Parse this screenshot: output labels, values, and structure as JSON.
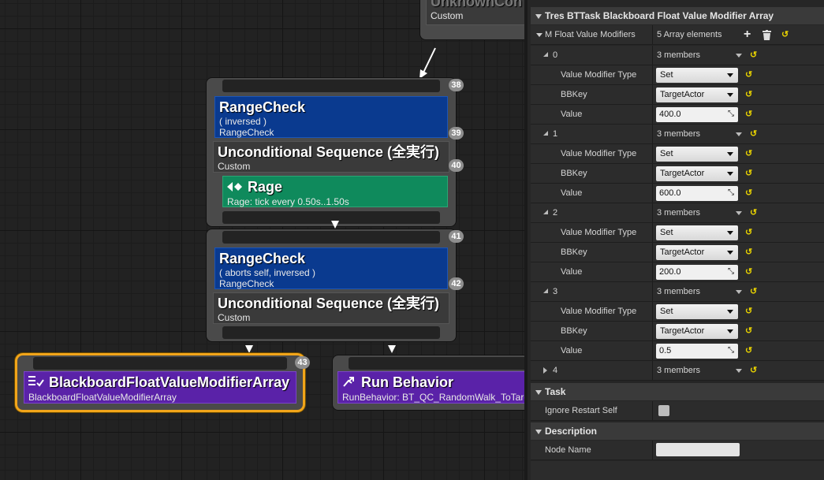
{
  "graph": {
    "top_node": {
      "title": "UnknownCon",
      "sub": "Custom"
    },
    "block1": {
      "badge_top": "38",
      "range": {
        "title": "RangeCheck",
        "line1": "( inversed )",
        "line2": "RangeCheck",
        "badge": "39"
      },
      "seq": {
        "title": "Unconditional Sequence (全実行)",
        "sub": "Custom",
        "badge": "40"
      },
      "rage": {
        "title": "Rage",
        "sub": "Rage: tick every 0.50s..1.50s"
      }
    },
    "block2": {
      "badge_top": "41",
      "range": {
        "title": "RangeCheck",
        "line1": "( aborts self, inversed )",
        "line2": "RangeCheck",
        "badge": "42"
      },
      "seq": {
        "title": "Unconditional Sequence (全実行)",
        "sub": "Custom"
      }
    },
    "bb_node": {
      "title": "BlackboardFloatValueModifierArray",
      "sub": "BlackboardFloatValueModifierArray",
      "badge": "43"
    },
    "run_node": {
      "title": "Run Behavior",
      "sub": "RunBehavior: BT_QC_RandomWalk_ToTarg"
    }
  },
  "details": {
    "header": "Tres BTTask Blackboard Float Value Modifier Array",
    "array_label": "M Float Value Modifiers",
    "array_value": "5 Array elements",
    "elements": [
      {
        "index": "0",
        "members": "3 members",
        "type_label": "Value Modifier Type",
        "type_value": "Set",
        "key_label": "BBKey",
        "key_value": "TargetActor",
        "value_label": "Value",
        "value": "400.0"
      },
      {
        "index": "1",
        "members": "3 members",
        "type_label": "Value Modifier Type",
        "type_value": "Set",
        "key_label": "BBKey",
        "key_value": "TargetActor",
        "value_label": "Value",
        "value": "600.0"
      },
      {
        "index": "2",
        "members": "3 members",
        "type_label": "Value Modifier Type",
        "type_value": "Set",
        "key_label": "BBKey",
        "key_value": "TargetActor",
        "value_label": "Value",
        "value": "200.0"
      },
      {
        "index": "3",
        "members": "3 members",
        "type_label": "Value Modifier Type",
        "type_value": "Set",
        "key_label": "BBKey",
        "key_value": "TargetActor",
        "value_label": "Value",
        "value": "0.5"
      }
    ],
    "collapsed": {
      "index": "4",
      "members": "3 members"
    },
    "task_header": "Task",
    "ignore_restart_label": "Ignore Restart Self",
    "description_header": "Description",
    "node_name_label": "Node Name",
    "node_name_value": ""
  }
}
